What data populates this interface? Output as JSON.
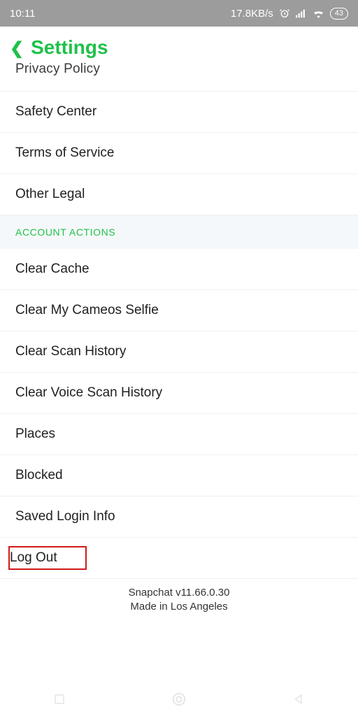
{
  "status_bar": {
    "time": "10:11",
    "net_speed": "17.8KB/s",
    "battery": "43"
  },
  "header": {
    "title": "Settings"
  },
  "partial_row": "Privacy Policy",
  "legal_rows": [
    "Safety Center",
    "Terms of Service",
    "Other Legal"
  ],
  "section_header": "ACCOUNT ACTIONS",
  "action_rows": [
    "Clear Cache",
    "Clear My Cameos Selfie",
    "Clear Scan History",
    "Clear Voice Scan History",
    "Places",
    "Blocked",
    "Saved Login Info"
  ],
  "logout_label": "Log Out",
  "footer": {
    "line1": "Snapchat v11.66.0.30",
    "line2": "Made in Los Angeles"
  }
}
